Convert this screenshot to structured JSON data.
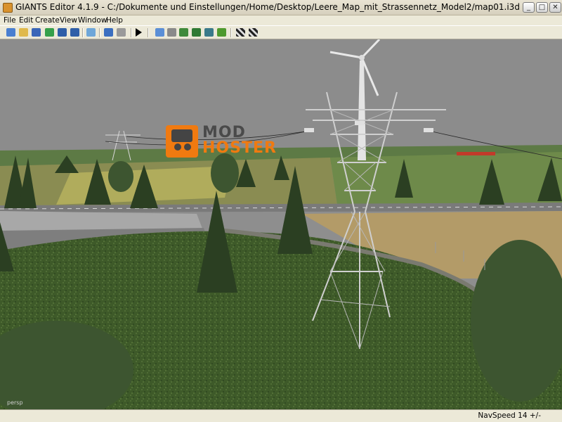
{
  "window": {
    "title": "GIANTS Editor 4.1.9 - C:/Dokumente und Einstellungen/Home/Desktop/Leere_Map_mit_Strassennetz_Model2/map01.i3d",
    "controls": [
      "_",
      "□",
      "✕"
    ]
  },
  "menu": {
    "items": [
      {
        "label": "File"
      },
      {
        "label": "Edit"
      },
      {
        "label": "Create"
      },
      {
        "label": "View"
      },
      {
        "label": "Window"
      },
      {
        "label": "Help"
      }
    ]
  },
  "toolbar": {
    "icons": [
      "new-icon",
      "open-icon",
      "save-list-icon",
      "refresh-icon",
      "save-icon",
      "save-as-icon",
      "import-icon",
      "undo-icon",
      "redo-icon",
      "play-icon",
      "home-icon",
      "magnet-icon",
      "terrain-paint-icon",
      "terrain-sculpt-icon",
      "terrain-smooth-icon",
      "foliage-icon",
      "checker-icon",
      "checker-select-icon"
    ]
  },
  "viewport": {
    "camera_label": "persp",
    "watermark": {
      "line1": "MOD",
      "line2": "HOSTER"
    }
  },
  "status": {
    "navspeed": "NavSpeed 14 +/-"
  },
  "colors": {
    "sky": "#8c8c8c",
    "grass": "#3f5c2a",
    "tree": "#2b3f22",
    "pylon": "#c8c8c8",
    "watermark_orange": "#f07a10"
  }
}
